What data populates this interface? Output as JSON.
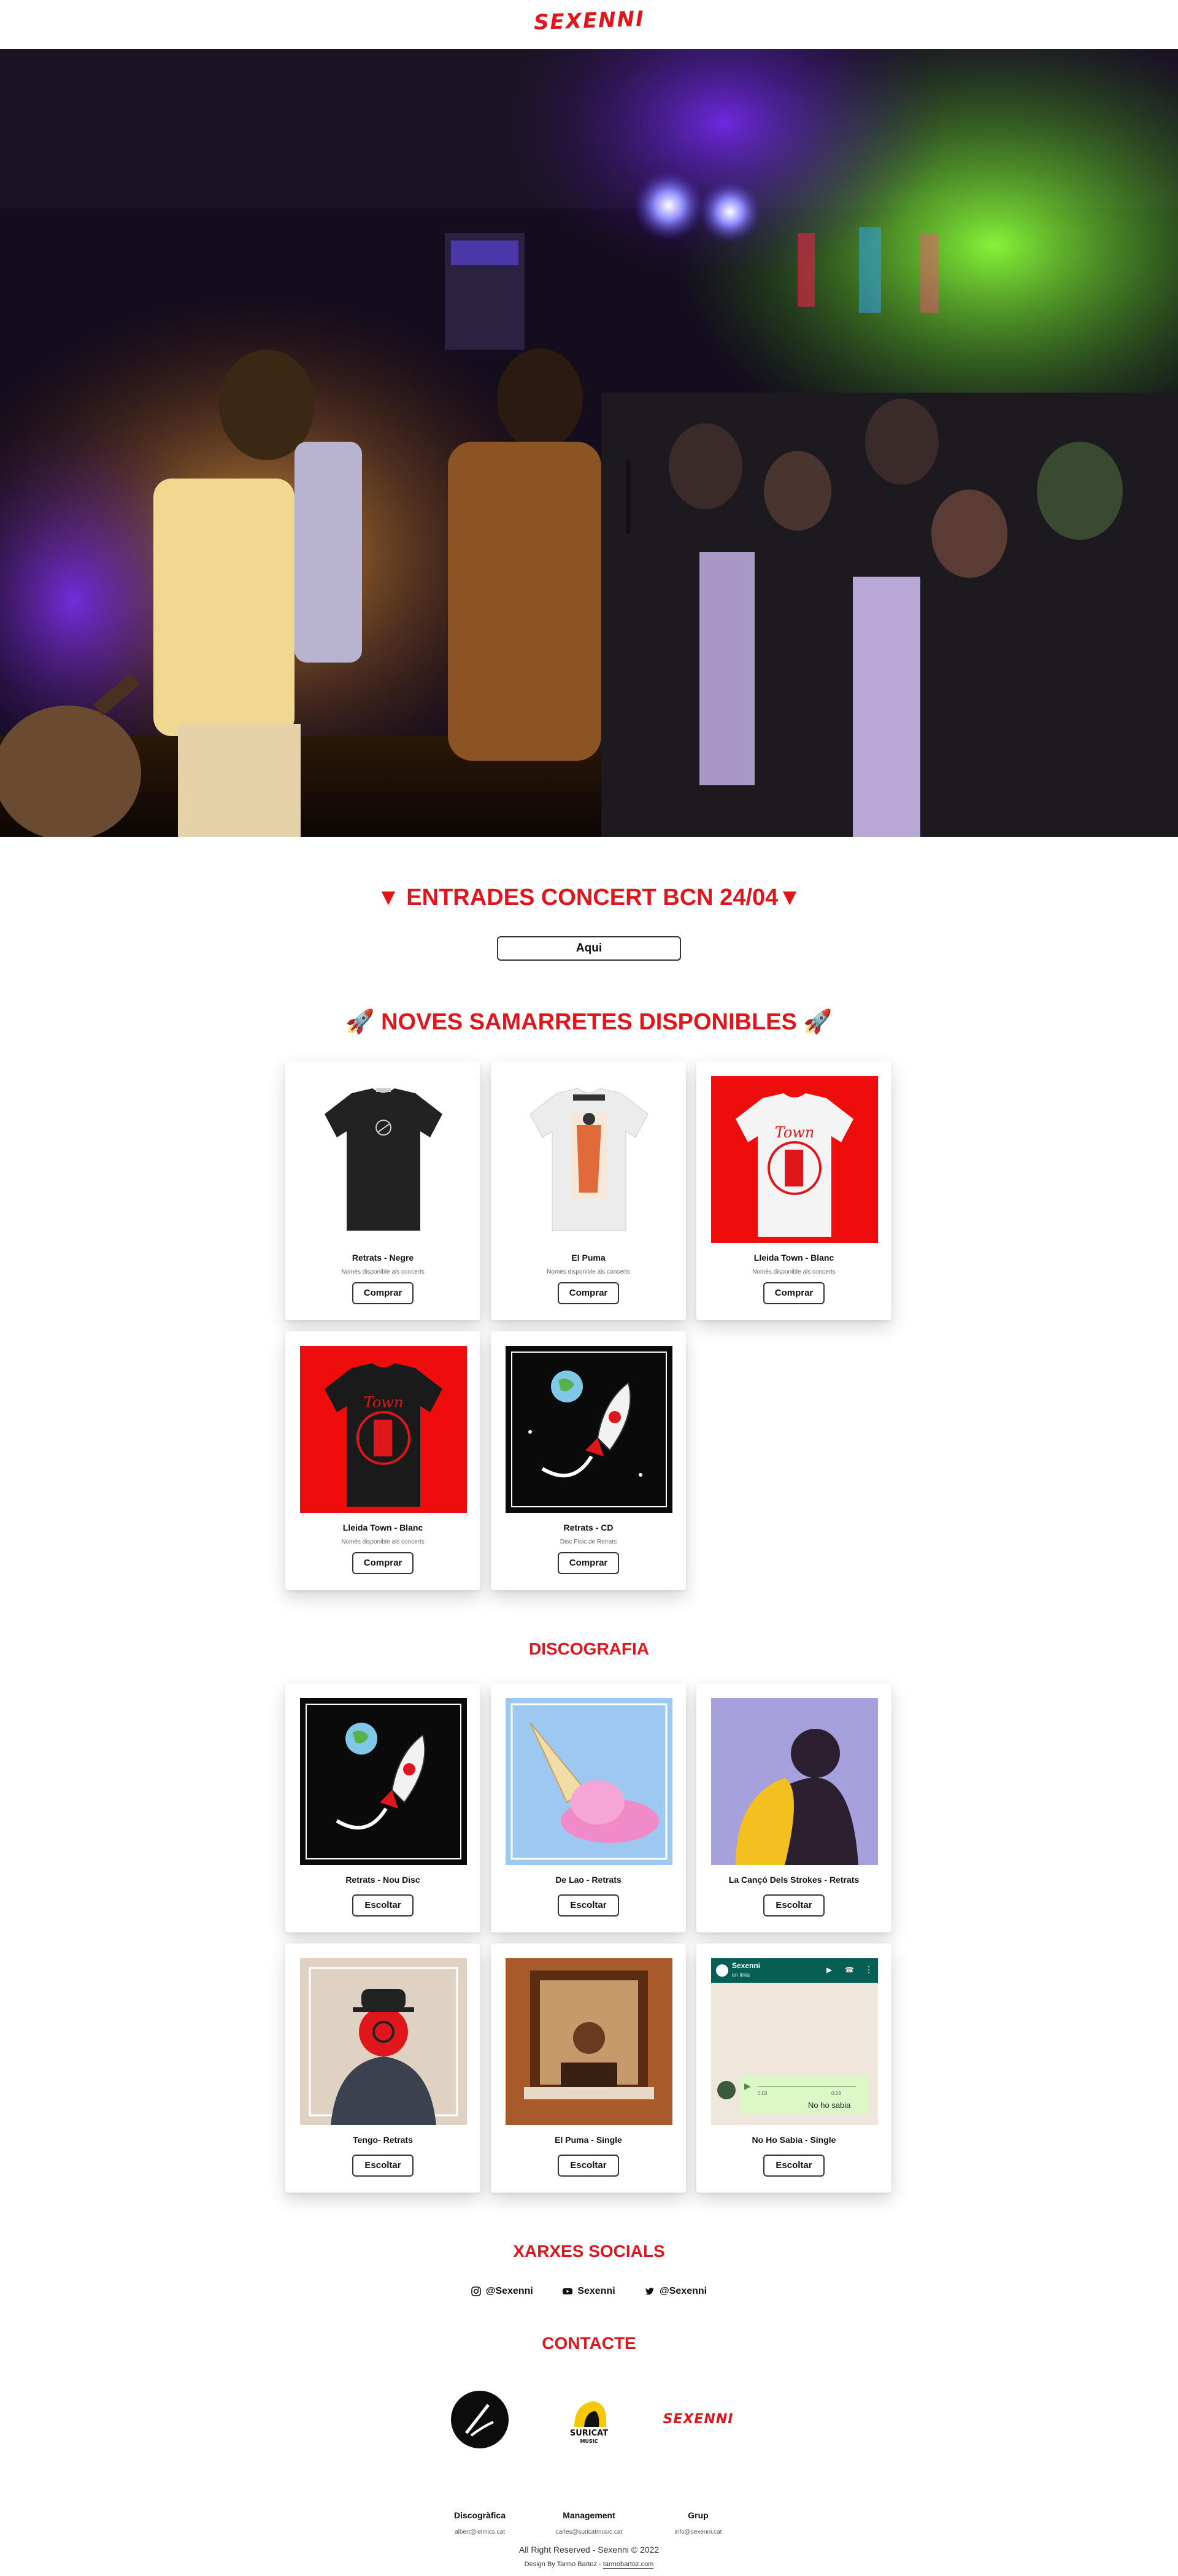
{
  "header": {
    "logo": "SEXENNI"
  },
  "concert": {
    "title": "▼ ENTRADES CONCERT BCN 24/04▼",
    "button": "Aqui"
  },
  "merch": {
    "title": "🚀 NOVES SAMARRETES DISPONIBLES 🚀",
    "items": [
      {
        "name": "Retrats - Negre",
        "desc": "Només disponible als concerts",
        "button": "Comprar",
        "image": "black-tshirt"
      },
      {
        "name": "El Puma",
        "desc": "Només disponible als concerts",
        "button": "Comprar",
        "image": "white-tshirt-print"
      },
      {
        "name": "Lleida Town - Blanc",
        "desc": "Només disponible als concerts",
        "button": "Comprar",
        "image": "white-tshirt-red-bg"
      },
      {
        "name": "Lleida Town - Blanc",
        "desc": "Només disponible als concerts",
        "button": "Comprar",
        "image": "black-tshirt-red-bg"
      },
      {
        "name": "Retrats - CD",
        "desc": "Disc Físic de Retrats",
        "button": "Comprar",
        "image": "rocket-cover"
      }
    ]
  },
  "discography": {
    "title": "DISCOGRAFIA",
    "items": [
      {
        "name": "Retrats - Nou Disc",
        "button": "Escoltar",
        "image": "rocket-cover"
      },
      {
        "name": "De Lao - Retrats",
        "button": "Escoltar",
        "image": "icecream-cover"
      },
      {
        "name": "La Cançó Dels Strokes - Retrats",
        "button": "Escoltar",
        "image": "lilac-figure-cover"
      },
      {
        "name": "Tengo- Retrats",
        "button": "Escoltar",
        "image": "bowler-hat-cover"
      },
      {
        "name": "El Puma - Single",
        "button": "Escoltar",
        "image": "window-photo-cover"
      },
      {
        "name": "No Ho Sabia - Single",
        "button": "Escoltar",
        "image": "whatsapp-cover"
      }
    ],
    "whatsapp": {
      "contact": "Sexenni",
      "status": "en línia",
      "message": "No ho sabia",
      "time1": "0:03",
      "time2": "0:23"
    }
  },
  "socials": {
    "title": "XARXES SOCIALS",
    "items": [
      {
        "icon": "instagram-icon",
        "label": "@Sexenni"
      },
      {
        "icon": "youtube-icon",
        "label": "Sexenni"
      },
      {
        "icon": "twitter-icon",
        "label": "@Sexenni"
      }
    ]
  },
  "contact": {
    "title": "CONTACTE",
    "items": [
      {
        "role": "Discogràfica",
        "email": "albert@ielmics.cat",
        "logo": "label-logo"
      },
      {
        "role": "Management",
        "email": "carles@suricatmusic.cat",
        "logo": "suricat-logo",
        "logo_text": "SURICAT",
        "logo_sub": "MUSIC"
      },
      {
        "role": "Grup",
        "email": "info@sexenni.cat",
        "logo": "sexenni-logo",
        "logo_text": "SEXENNI"
      }
    ]
  },
  "footer": {
    "rights": "All Right Reserved - Sexenni © 2022",
    "credit_prefix": "Design By Tarmo Bartoz - ",
    "credit_link": "tarmobartoz.com"
  },
  "colors": {
    "accent": "#e0161d"
  }
}
